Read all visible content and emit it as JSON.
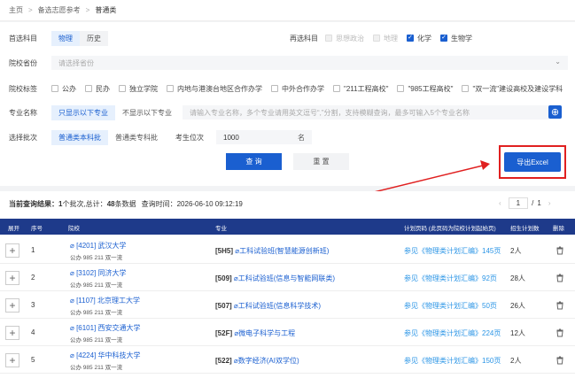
{
  "breadcrumb": [
    "主页",
    "备选志愿参考",
    "普通类"
  ],
  "filters": {
    "subject_first": {
      "label": "首选科目",
      "options": [
        "物理",
        "历史"
      ],
      "selected": "物理"
    },
    "subject_second": {
      "label": "再选科目",
      "options": [
        {
          "label": "思想政治",
          "checked": false,
          "disabled": true
        },
        {
          "label": "地理",
          "checked": false,
          "disabled": true
        },
        {
          "label": "化学",
          "checked": true,
          "disabled": false
        },
        {
          "label": "生物学",
          "checked": true,
          "disabled": false
        }
      ]
    },
    "province": {
      "label": "院校省份",
      "placeholder": "请选择省份"
    },
    "tags": {
      "label": "院校标签",
      "options": [
        "公办",
        "民办",
        "独立学院",
        "内地与港澳台地区合作办学",
        "中外合作办学",
        "\"211工程高校\"",
        "\"985工程高校\"",
        "\"双一流\"建设高校及建设学科"
      ]
    },
    "major": {
      "label": "专业名称",
      "options": [
        "只显示以下专业",
        "不显示以下专业"
      ],
      "selected": "只显示以下专业",
      "placeholder": "请输入专业名称，多个专业请用英文逗号“,”分割，支持模糊查询，最多可输入5个专业名称"
    },
    "batch": {
      "label": "选择批次",
      "options": [
        "普通类本科批",
        "普通类专科批"
      ],
      "selected": "普通类本科批"
    },
    "rank": {
      "label": "考生位次",
      "value": "1000",
      "unit": "名"
    }
  },
  "actions": {
    "query": "查 询",
    "reset": "重 置",
    "export": "导出Excel"
  },
  "result": {
    "prefix": "当前查询结果：",
    "count1": "1",
    "mid1": "个批次,总计：",
    "count2": "48",
    "mid2": "条数据",
    "time_label": "查询时间：",
    "time": "2026-06-10 09:12:19",
    "page_current": "1",
    "page_sep": "/",
    "page_total": "1"
  },
  "columns": [
    "展开",
    "序号",
    "院校",
    "专业",
    "计划页码 (此页码为院校计划起始页)",
    "招生计划数",
    "删除"
  ],
  "rows": [
    {
      "no": "1",
      "code": "[4201]",
      "name": "武汉大学",
      "tags": "公办  985  211  双一流",
      "mcode": "[5H5]",
      "major": "工科试验班(智慧能源创新班)",
      "page": "参见《物理类计划汇编》145页",
      "plan": "2人"
    },
    {
      "no": "2",
      "code": "[3102]",
      "name": "同济大学",
      "tags": "公办  985  211  双一流",
      "mcode": "[509]",
      "major": "工科试验班(信息与智能网联类)",
      "page": "参见《物理类计划汇编》92页",
      "plan": "28人"
    },
    {
      "no": "3",
      "code": "[1107]",
      "name": "北京理工大学",
      "tags": "公办  985  211  双一流",
      "mcode": "[507]",
      "major": "工科试验班(信息科学技术)",
      "page": "参见《物理类计划汇编》50页",
      "plan": "26人"
    },
    {
      "no": "4",
      "code": "[6101]",
      "name": "西安交通大学",
      "tags": "公办  985  211  双一流",
      "mcode": "[52F]",
      "major": "微电子科学与工程",
      "page": "参见《物理类计划汇编》224页",
      "plan": "12人"
    },
    {
      "no": "5",
      "code": "[4224]",
      "name": "华中科技大学",
      "tags": "公办  985  211  双一流",
      "mcode": "[522]",
      "major": "数字经济(AI双学位)",
      "page": "参见《物理类计划汇编》150页",
      "plan": "2人"
    }
  ]
}
